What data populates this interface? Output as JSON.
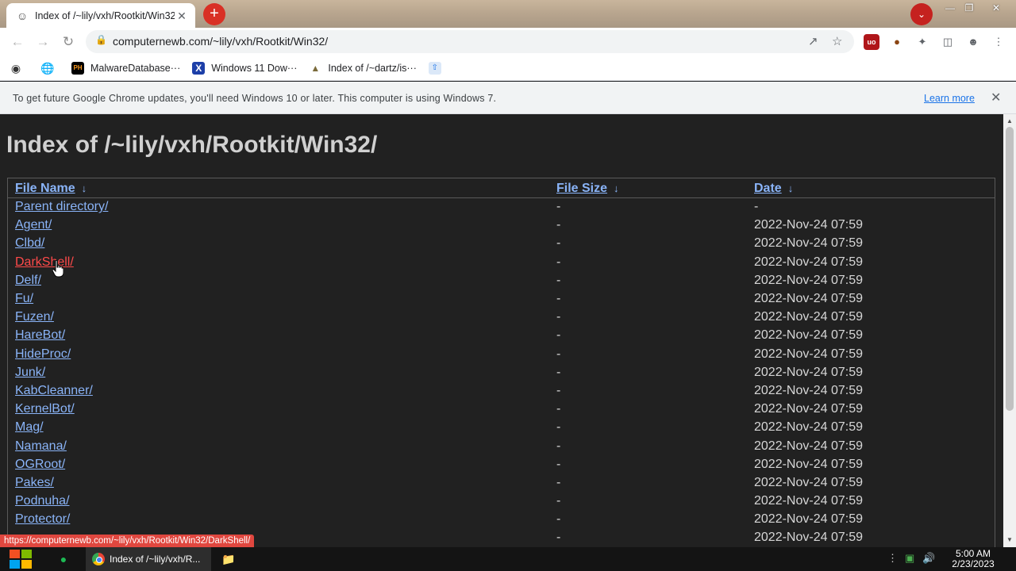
{
  "tab": {
    "title": "Index of /~lily/vxh/Rootkit/Win32/",
    "close_icon": "close-icon"
  },
  "toolbar": {
    "url": "computernewb.com/~lily/vxh/Rootkit/Win32/"
  },
  "bookmarks": [
    {
      "label": "",
      "icon": "github-icon"
    },
    {
      "label": "",
      "icon": "globe-icon"
    },
    {
      "label": "MalwareDatabase···",
      "icon": "ph-icon"
    },
    {
      "label": "Windows 11 Dow···",
      "icon": "x-icon"
    },
    {
      "label": "Index of /~dartz/is···",
      "icon": "directory-icon"
    },
    {
      "label": "",
      "icon": "upload-icon"
    }
  ],
  "infobar": {
    "message": "To get future Google Chrome updates, you'll need Windows 10 or later. This computer is using Windows 7.",
    "link": "Learn more"
  },
  "page": {
    "heading": "Index of /~lily/vxh/Rootkit/Win32/",
    "columns": {
      "name": "File Name",
      "size": "File Size",
      "date": "Date",
      "sort_arrow": "↓"
    },
    "rows": [
      {
        "name": "Parent directory/",
        "size": "-",
        "date": "-"
      },
      {
        "name": "Agent/",
        "size": "-",
        "date": "2022-Nov-24 07:59"
      },
      {
        "name": "Clbd/",
        "size": "-",
        "date": "2022-Nov-24 07:59"
      },
      {
        "name": "DarkShell/",
        "size": "-",
        "date": "2022-Nov-24 07:59",
        "hovered": true
      },
      {
        "name": "Delf/",
        "size": "-",
        "date": "2022-Nov-24 07:59"
      },
      {
        "name": "Fu/",
        "size": "-",
        "date": "2022-Nov-24 07:59"
      },
      {
        "name": "Fuzen/",
        "size": "-",
        "date": "2022-Nov-24 07:59"
      },
      {
        "name": "HareBot/",
        "size": "-",
        "date": "2022-Nov-24 07:59"
      },
      {
        "name": "HideProc/",
        "size": "-",
        "date": "2022-Nov-24 07:59"
      },
      {
        "name": "Junk/",
        "size": "-",
        "date": "2022-Nov-24 07:59"
      },
      {
        "name": "KabCleanner/",
        "size": "-",
        "date": "2022-Nov-24 07:59"
      },
      {
        "name": "KernelBot/",
        "size": "-",
        "date": "2022-Nov-24 07:59"
      },
      {
        "name": "Mag/",
        "size": "-",
        "date": "2022-Nov-24 07:59"
      },
      {
        "name": "Namana/",
        "size": "-",
        "date": "2022-Nov-24 07:59"
      },
      {
        "name": "OGRoot/",
        "size": "-",
        "date": "2022-Nov-24 07:59"
      },
      {
        "name": "Pakes/",
        "size": "-",
        "date": "2022-Nov-24 07:59"
      },
      {
        "name": "Podnuha/",
        "size": "-",
        "date": "2022-Nov-24 07:59"
      },
      {
        "name": "Protector/",
        "size": "-",
        "date": "2022-Nov-24 07:59"
      },
      {
        "name": "",
        "size": "-",
        "date": "2022-Nov-24 07:59"
      }
    ]
  },
  "status_url": "https://computernewb.com/~lily/vxh/Rootkit/Win32/DarkShell/",
  "taskbar": {
    "chrome_label": "Index of /~lily/vxh/R...",
    "time": "5:00 AM",
    "date": "2/23/2023"
  },
  "colors": {
    "page_bg": "#212121",
    "link": "#8ab4f8",
    "hover_link": "#ff4a4a",
    "new_tab_button": "#d93025",
    "status_bubble": "#e0473f"
  }
}
